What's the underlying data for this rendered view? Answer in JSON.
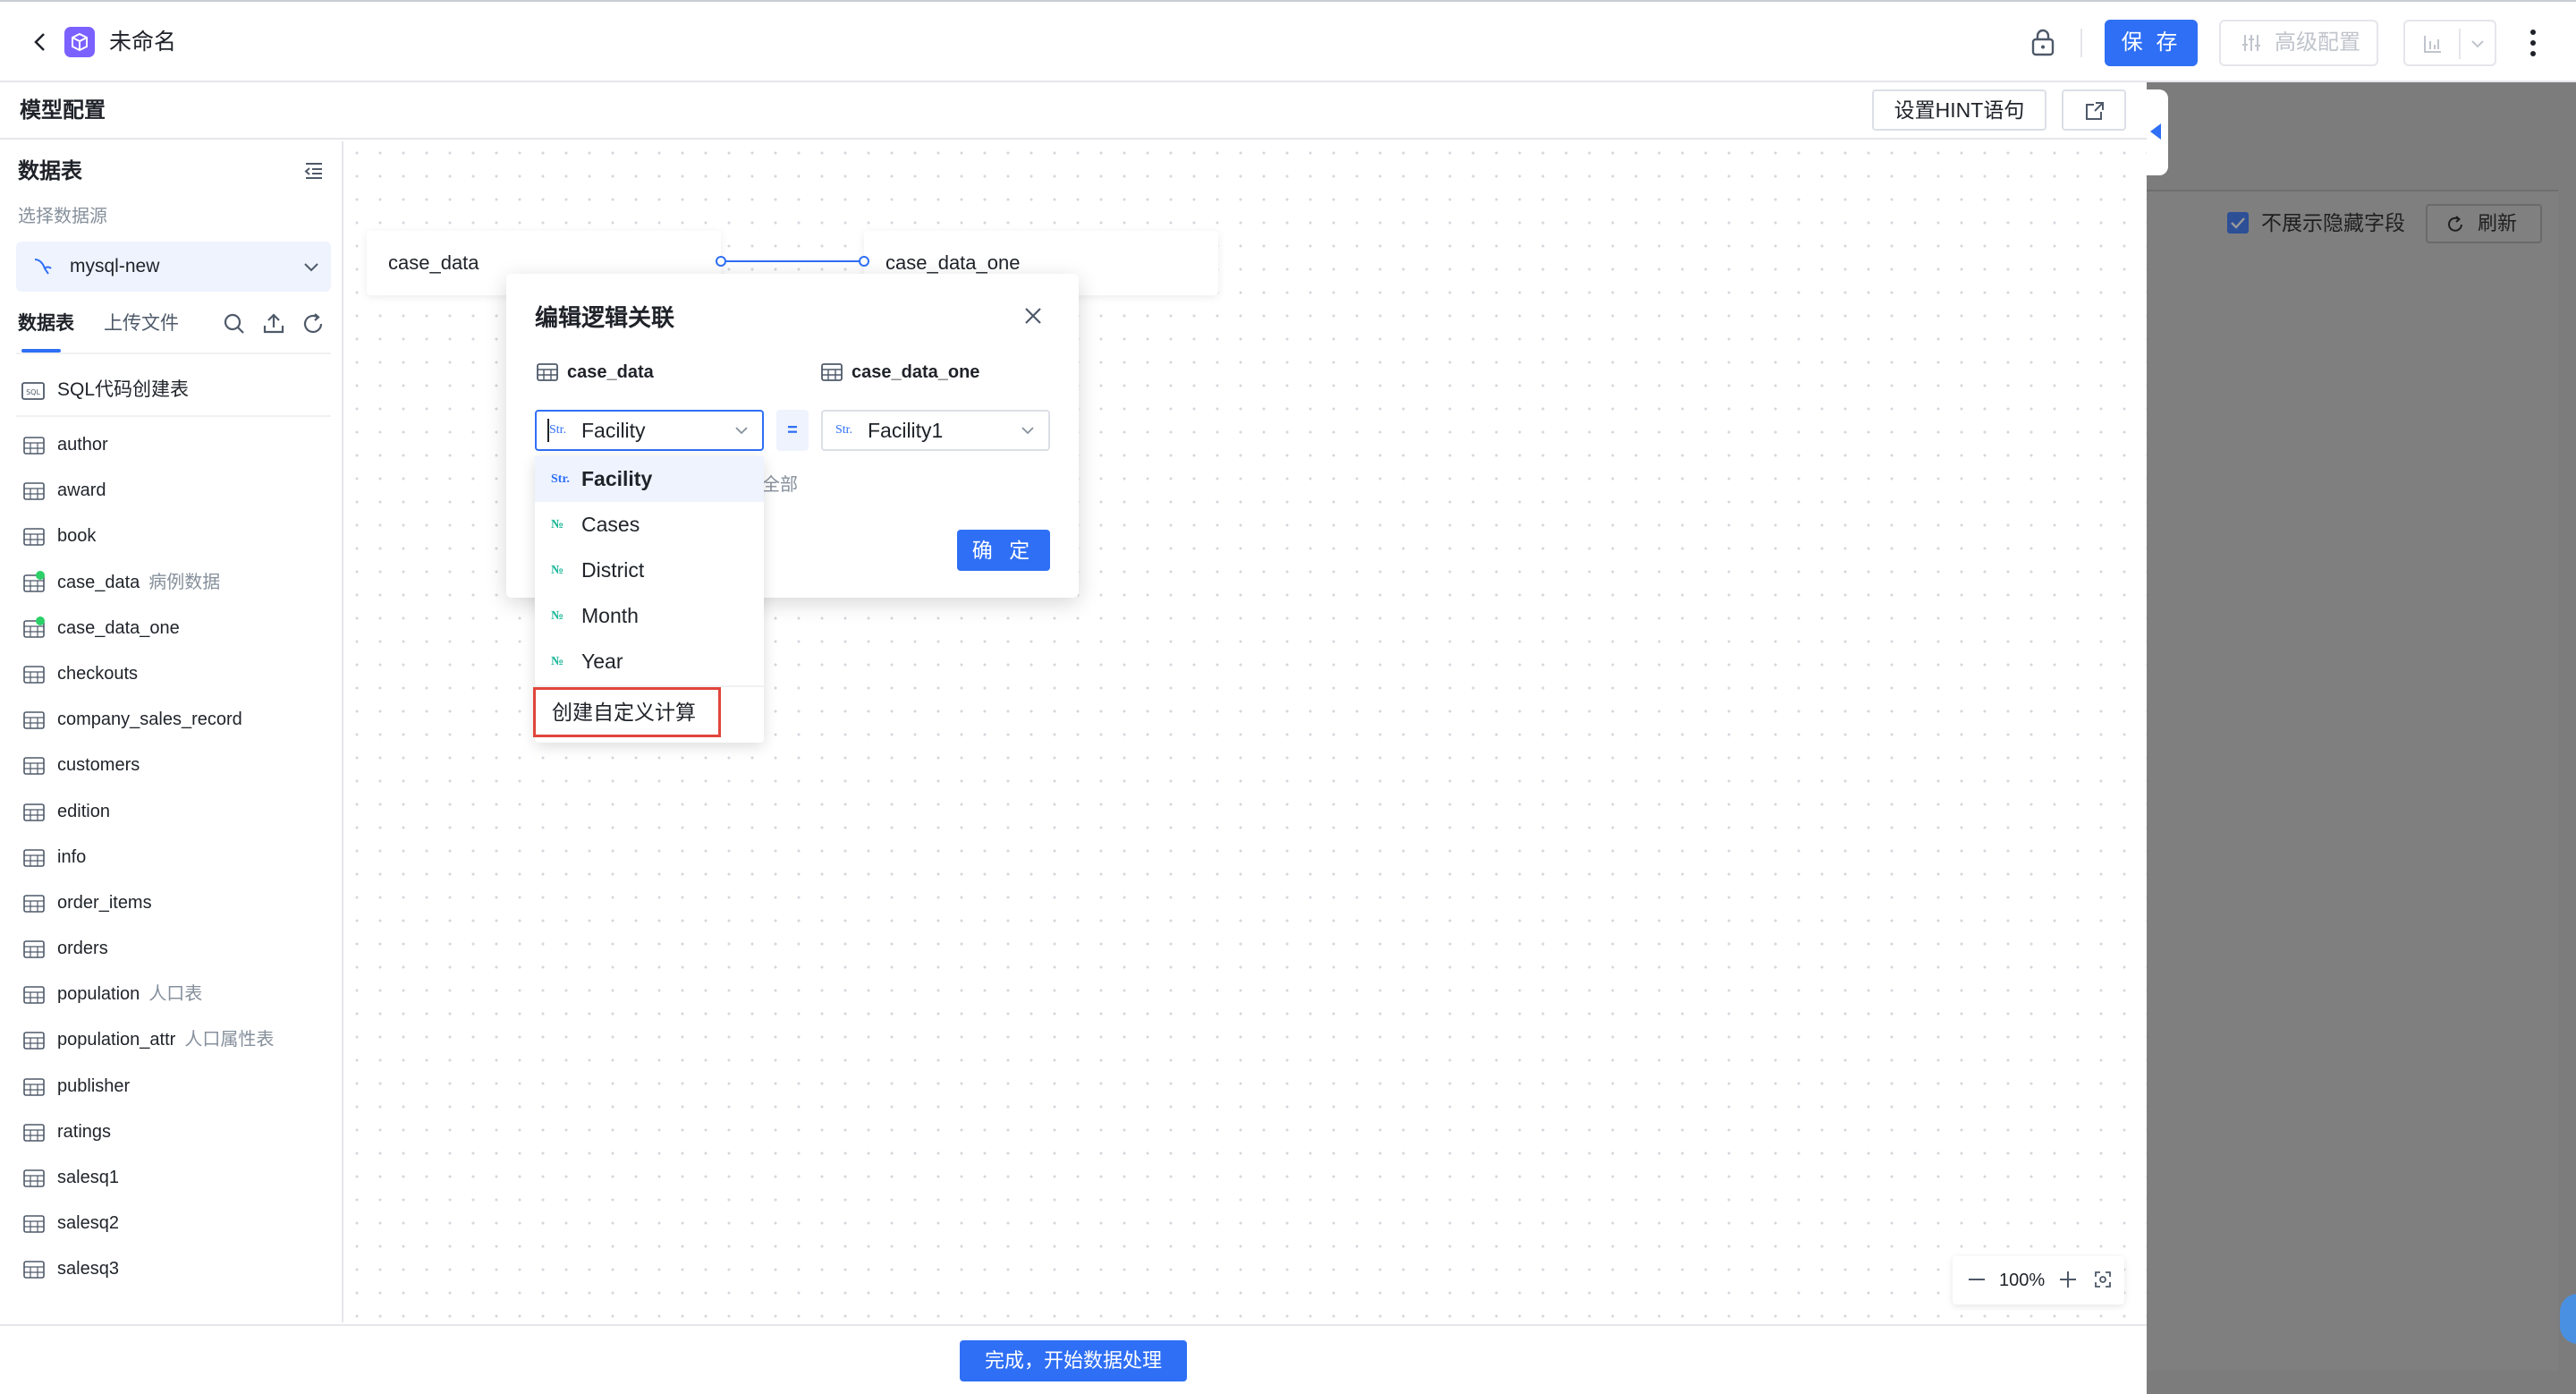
{
  "window": {
    "doc_title": "未命名",
    "save_label": "保 存",
    "advanced_label": "高级配置"
  },
  "subheader": {
    "title": "模型配置",
    "hint_button": "设置HINT语句"
  },
  "sidebar": {
    "title": "数据表",
    "source_label": "选择数据源",
    "source_value": "mysql-new",
    "tabs": [
      "数据表",
      "上传文件"
    ],
    "sql_create": "SQL代码创建表",
    "tables": [
      {
        "name": "author",
        "alias": "",
        "used": false
      },
      {
        "name": "award",
        "alias": "",
        "used": false
      },
      {
        "name": "book",
        "alias": "",
        "used": false
      },
      {
        "name": "case_data",
        "alias": "病例数据",
        "used": true
      },
      {
        "name": "case_data_one",
        "alias": "",
        "used": true
      },
      {
        "name": "checkouts",
        "alias": "",
        "used": false
      },
      {
        "name": "company_sales_record",
        "alias": "",
        "used": false
      },
      {
        "name": "customers",
        "alias": "",
        "used": false
      },
      {
        "name": "edition",
        "alias": "",
        "used": false
      },
      {
        "name": "info",
        "alias": "",
        "used": false
      },
      {
        "name": "order_items",
        "alias": "",
        "used": false
      },
      {
        "name": "orders",
        "alias": "",
        "used": false
      },
      {
        "name": "population",
        "alias": "人口表",
        "used": false
      },
      {
        "name": "population_attr",
        "alias": "人口属性表",
        "used": false
      },
      {
        "name": "publisher",
        "alias": "",
        "used": false
      },
      {
        "name": "ratings",
        "alias": "",
        "used": false
      },
      {
        "name": "salesq1",
        "alias": "",
        "used": false
      },
      {
        "name": "salesq2",
        "alias": "",
        "used": false
      },
      {
        "name": "salesq3",
        "alias": "",
        "used": false
      }
    ]
  },
  "canvas": {
    "node_left": "case_data",
    "node_right": "case_data_one",
    "zoom": "100%"
  },
  "dialog": {
    "title": "编辑逻辑关联",
    "left_table": "case_data",
    "right_table": "case_data_one",
    "left_field": "Facility",
    "right_field": "Facility1",
    "left_field_type": "Str.",
    "right_field_type": "Str.",
    "operator": "=",
    "partial_text": "全部",
    "confirm": "确 定"
  },
  "dropdown": {
    "options": [
      {
        "type": "Str.",
        "label": "Facility",
        "selected": true
      },
      {
        "type": "№",
        "label": "Cases",
        "selected": false
      },
      {
        "type": "№",
        "label": "District",
        "selected": false
      },
      {
        "type": "№",
        "label": "Month",
        "selected": false
      },
      {
        "type": "№",
        "label": "Year",
        "selected": false
      }
    ],
    "custom_calc": "创建自定义计算"
  },
  "right_panel": {
    "hide_fields_label": "不展示隐藏字段",
    "hide_fields_checked": true,
    "refresh_label": "刷新"
  },
  "bottom": {
    "finish_label": "完成，开始数据处理"
  },
  "colors": {
    "accent": "#2f6ff5",
    "highlight_border": "#e0453b",
    "number_type": "#1fb89a",
    "used_dot": "#2ccf68"
  }
}
